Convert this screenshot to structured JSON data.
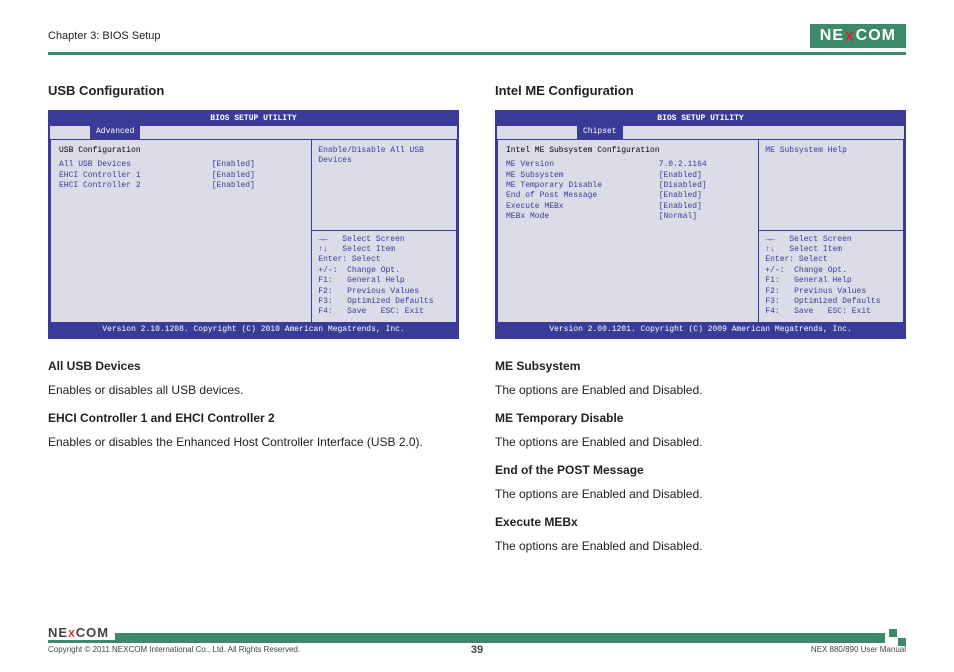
{
  "header": {
    "chapter": "Chapter 3: BIOS Setup",
    "logo_left": "NE",
    "logo_x": "X",
    "logo_right": "COM"
  },
  "left": {
    "title": "USB Configuration",
    "bios": {
      "title": "BIOS SETUP UTILITY",
      "tab_spacer": " ",
      "tab_active": "Advanced",
      "heading": "USB Configuration",
      "rows": [
        {
          "lbl": "All USB Devices",
          "val": "[Enabled]"
        },
        {
          "lbl": " ",
          "val": " "
        },
        {
          "lbl": "EHCI Controller 1",
          "val": "[Enabled]"
        },
        {
          "lbl": "EHCI Controller 2",
          "val": "[Enabled]"
        }
      ],
      "help": "Enable/Disable All USB Devices",
      "keys": "→←   Select Screen\n↑↓   Select Item\nEnter: Select\n+/-:  Change Opt.\nF1:   General Help\nF2:   Previous Values\nF3:   Optimized Defaults\nF4:   Save   ESC: Exit",
      "footer": "Version 2.10.1208. Copyright (C) 2010 American Megatrends, Inc."
    },
    "desc": [
      {
        "h": "All USB Devices",
        "p": "Enables or disables all USB devices."
      },
      {
        "h": "EHCI Controller 1 and EHCI Controller 2",
        "p": "Enables or disables the Enhanced Host Controller Interface (USB 2.0)."
      }
    ]
  },
  "right": {
    "title": "Intel ME Configuration",
    "bios": {
      "title": "BIOS SETUP UTILITY",
      "tab_spacer": " ",
      "tab_active": "Chipset",
      "heading": "Intel ME Subsystem Configuration",
      "rows": [
        {
          "lbl": "ME Version",
          "val": "7.0.2.1164"
        },
        {
          "lbl": " ",
          "val": " "
        },
        {
          "lbl": "ME Subsystem",
          "val": "[Enabled]"
        },
        {
          "lbl": "ME Temporary Disable",
          "val": "[Disabled]"
        },
        {
          "lbl": "End of Post Message",
          "val": "[Enabled]"
        },
        {
          "lbl": " ",
          "val": " "
        },
        {
          "lbl": "Execute MEBx",
          "val": "[Enabled]"
        },
        {
          "lbl": "MEBx Mode",
          "val": "[Normal]"
        }
      ],
      "help": "ME Subsystem Help",
      "keys": "→←   Select Screen\n↑↓   Select Item\nEnter: Select\n+/-:  Change Opt.\nF1:   General Help\nF2:   Previous Values\nF3:   Optimized Defaults\nF4:   Save   ESC: Exit",
      "footer": "Version 2.00.1201. Copyright (C) 2009 American Megatrends, Inc."
    },
    "desc": [
      {
        "h": "ME Subsystem",
        "p": "The options are Enabled and Disabled."
      },
      {
        "h": "ME Temporary Disable",
        "p": "The options are Enabled and Disabled."
      },
      {
        "h": "End of the POST Message",
        "p": "The options are Enabled and Disabled."
      },
      {
        "h": "Execute MEBx",
        "p": "The options are Enabled and Disabled."
      }
    ]
  },
  "footer": {
    "copyright": "Copyright © 2011 NEXCOM International Co., Ltd. All Rights Reserved.",
    "page": "39",
    "manual": "NEX 880/890 User Manual",
    "logo_left": "NE",
    "logo_x": "X",
    "logo_right": "COM"
  }
}
